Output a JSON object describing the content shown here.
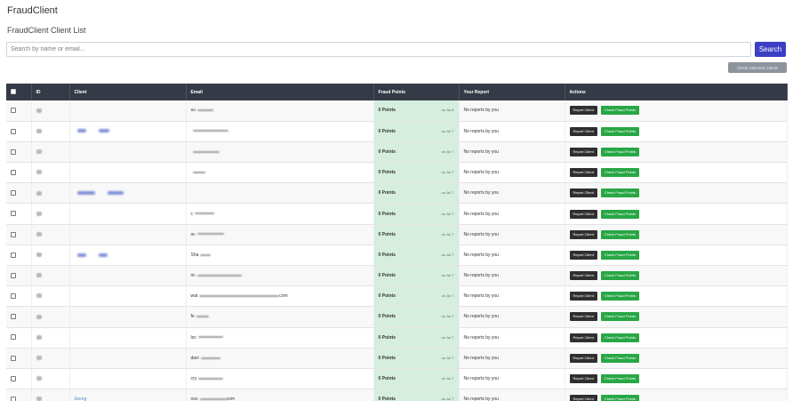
{
  "app": {
    "title": "FraudClient"
  },
  "page": {
    "title": "FraudClient Client List"
  },
  "search": {
    "placeholder": "Search by name or email...",
    "button": "Search"
  },
  "bulk": {
    "check_selected": "Check Selected Clients"
  },
  "table": {
    "headers": [
      "",
      "ID",
      "Client",
      "Email",
      "Fraud Points",
      "Your Report",
      "Actions"
    ],
    "action_report": "Report Client",
    "action_check": "Check Fraud Points",
    "rows": [
      {
        "email": "su",
        "points": "0 Points",
        "date": "on Jul 8",
        "report": "No reports by you"
      },
      {
        "email": "",
        "points": "0 Points",
        "date": "on Jul 7",
        "report": "No reports by you"
      },
      {
        "email": "",
        "points": "0 Points",
        "date": "on Jul 7",
        "report": "No reports by you"
      },
      {
        "email": "",
        "points": "0 Points",
        "date": "on Jul 7",
        "report": "No reports by you"
      },
      {
        "email": "",
        "points": "0 Points",
        "date": "on Jul 7",
        "report": "No reports by you"
      },
      {
        "email": "c",
        "points": "0 Points",
        "date": "on Jul 7",
        "report": "No reports by you"
      },
      {
        "email": "oc",
        "points": "0 Points",
        "date": "on Jul 7",
        "report": "No reports by you"
      },
      {
        "email": "Sha",
        "points": "0 Points",
        "date": "on Jul 7",
        "report": "No reports by you"
      },
      {
        "email": "ric",
        "points": "0 Points",
        "date": "on Jul 7",
        "report": "No reports by you"
      },
      {
        "email": "wat",
        "email_suffix": "com",
        "points": "0 Points",
        "date": "on Jul 7",
        "report": "No reports by you"
      },
      {
        "email": "fe",
        "points": "0 Points",
        "date": "on Jul 7",
        "report": "No reports by you"
      },
      {
        "email": "loc",
        "points": "0 Points",
        "date": "on Jul 7",
        "report": "No reports by you"
      },
      {
        "email": "davi",
        "points": "0 Points",
        "date": "on Jul 7",
        "report": "No reports by you"
      },
      {
        "email": "cry",
        "points": "0 Points",
        "date": "on Jul 7",
        "report": "No reports by you"
      },
      {
        "client": "Georg",
        "email": "oso",
        "email_suffix": "com",
        "points": "0 Points",
        "date": "on Jul 7",
        "report": "No reports by you"
      }
    ]
  },
  "colors": {
    "header_bg": "#343a46",
    "search_button": "#3c3fc3",
    "fraud_cell": "#d6eedd",
    "check_button": "#28a745",
    "report_button": "#2f2f2f"
  }
}
